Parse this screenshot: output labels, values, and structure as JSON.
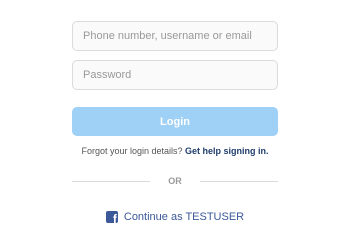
{
  "login_form": {
    "username_placeholder": "Phone number, username or email",
    "password_placeholder": "Password",
    "login_button": "Login"
  },
  "help": {
    "prefix": "Forgot your login details?",
    "link": "Get help signing in."
  },
  "divider": {
    "text": "OR"
  },
  "facebook": {
    "icon": "facebook-icon",
    "label": "Continue as TESTUSER"
  },
  "colors": {
    "login_button_bg": "#9fd0f5",
    "link": "#1f3d6d",
    "facebook_blue": "#3b5998",
    "field_border": "#dbdbdb"
  }
}
